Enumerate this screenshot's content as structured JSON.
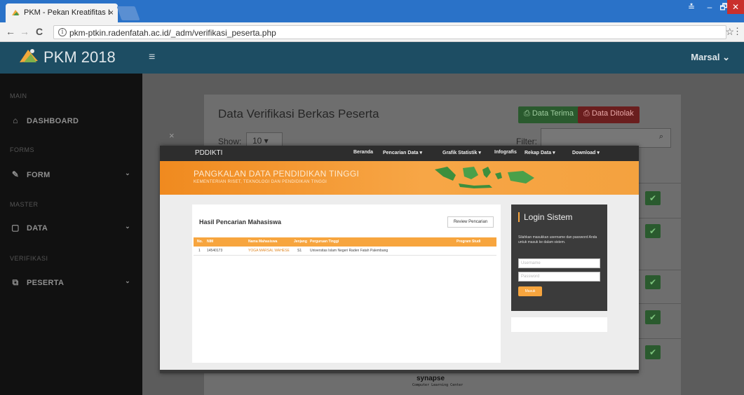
{
  "browser": {
    "tab_title": "PKM - Pekan Kreatifitas I",
    "tab_close": "×",
    "url": "pkm-ptkin.radenfatah.ac.id/_adm/verifikasi_peserta.php",
    "back": "←",
    "forward": "→",
    "reload": "C",
    "info_icon": "i",
    "bookmark_star": "☆",
    "menu": "⋮",
    "win_user": "≛",
    "win_minimize": "–",
    "win_restore": "🗗",
    "win_close": "✕"
  },
  "header": {
    "app_title": "PKM 2018",
    "menu_glyph": "≡",
    "user_name": "Marsal ⌄",
    "header_color": "#1d4d63"
  },
  "sidebar": {
    "sections": [
      {
        "label": "MAIN"
      },
      {
        "label": "FORMS"
      },
      {
        "label": "MASTER"
      },
      {
        "label": "VERIFIKASI"
      }
    ],
    "items": [
      {
        "label": "DASHBOARD",
        "icon": "home-icon",
        "glyph": "⌂",
        "chevron": ""
      },
      {
        "label": "FORM",
        "icon": "pencil-icon",
        "glyph": "✎",
        "chevron": "⌄"
      },
      {
        "label": "DATA",
        "icon": "file-icon",
        "glyph": "▢",
        "chevron": "⌄"
      },
      {
        "label": "PESERTA",
        "icon": "users-icon",
        "glyph": "⧉",
        "chevron": "⌄"
      }
    ]
  },
  "page": {
    "title": "Data Verifikasi Berkas Peserta",
    "btn_terima": "⎙ Data Terima",
    "btn_tolak": "⎙ Data Ditolak",
    "show_label": "Show:",
    "show_value": "10 ▾",
    "filter_label": "Filter:",
    "search_glyph": "⌕",
    "check_glyph": "✔",
    "modal_close": "×",
    "terima_color": "#2a5a2e",
    "tolak_color": "#6a1e1e"
  },
  "modal_image": {
    "brand": "PDDIKTI",
    "nav": [
      "Beranda",
      "Pencarian Data ▾",
      "Grafik Statistik ▾",
      "Infografis",
      "Rekap Data ▾",
      "Download ▾"
    ],
    "banner_title": "PANGKALAN DATA PENDIDIKAN TINGGI",
    "banner_subtitle": "KEMENTERIAN RISET, TEKNOLOGI DAN PENDIDIKAN TINGGI",
    "results_title": "Hasil Pencarian Mahasiswa",
    "review_button": "Review Pencarian",
    "columns": [
      "No.",
      "NIM",
      "Nama Mahasiswa",
      "Jenjang",
      "Perguruan Tinggi",
      "Program Studi"
    ],
    "rows": [
      [
        "1",
        "14540173",
        "YOGA MARSAL WAHESE",
        "S1",
        "Universitas Islam Negeri Raden Fatah Palembang",
        ""
      ]
    ],
    "login_title": "Login Sistem",
    "login_desc": "Silahkan masukkan username dan password Anda untuk masuk ke dalam sistem.",
    "username_placeholder": "Username",
    "password_placeholder": "Password",
    "login_button": "Masuk",
    "accent_color": "#f7a53e"
  },
  "watermark": {
    "title": "synapse",
    "subtitle": "Computer Learning Center"
  }
}
